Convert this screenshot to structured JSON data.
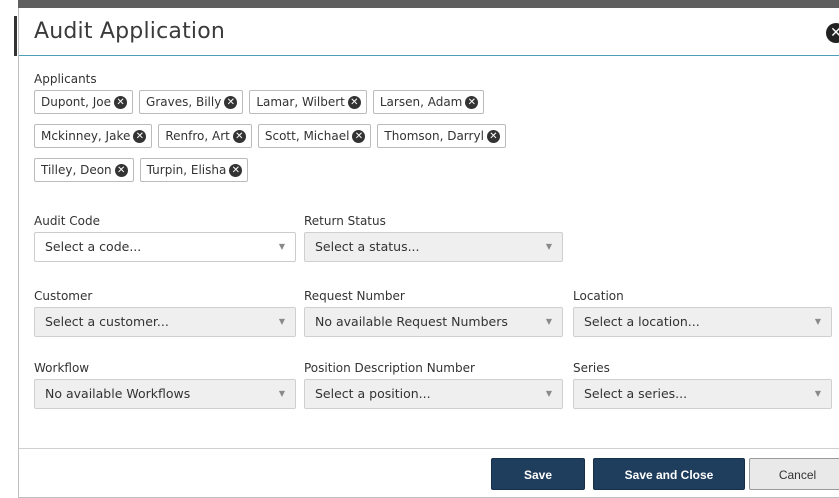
{
  "dialog": {
    "title": "Audit Application",
    "close_glyph": "✕"
  },
  "applicants": {
    "label": "Applicants",
    "rows": [
      [
        "Dupont, Joe",
        "Graves, Billy",
        "Lamar, Wilbert",
        "Larsen, Adam"
      ],
      [
        "Mckinney, Jake",
        "Renfro, Art",
        "Scott, Michael",
        "Thomson, Darryl"
      ],
      [
        "Tilley, Deon",
        "Turpin, Elisha"
      ]
    ],
    "remove_glyph": "✕"
  },
  "fields": {
    "audit_code": {
      "label": "Audit Code",
      "value": "Select a code..."
    },
    "return_status": {
      "label": "Return Status",
      "value": "Select a status..."
    },
    "customer": {
      "label": "Customer",
      "value": "Select a customer..."
    },
    "request_number": {
      "label": "Request Number",
      "value": "No available Request Numbers"
    },
    "location": {
      "label": "Location",
      "value": "Select a location..."
    },
    "workflow": {
      "label": "Workflow",
      "value": "No available Workflows"
    },
    "position_description_number": {
      "label": "Position Description Number",
      "value": "Select a position..."
    },
    "series": {
      "label": "Series",
      "value": "Select a series..."
    },
    "arrow_glyph": "▼"
  },
  "footer": {
    "save_label": "Save",
    "save_close_label": "Save and Close",
    "cancel_label": "Cancel"
  },
  "colors": {
    "primary_button": "#1f3d5c",
    "header_rule": "#4a9fb5",
    "select_background": "#efefef"
  }
}
